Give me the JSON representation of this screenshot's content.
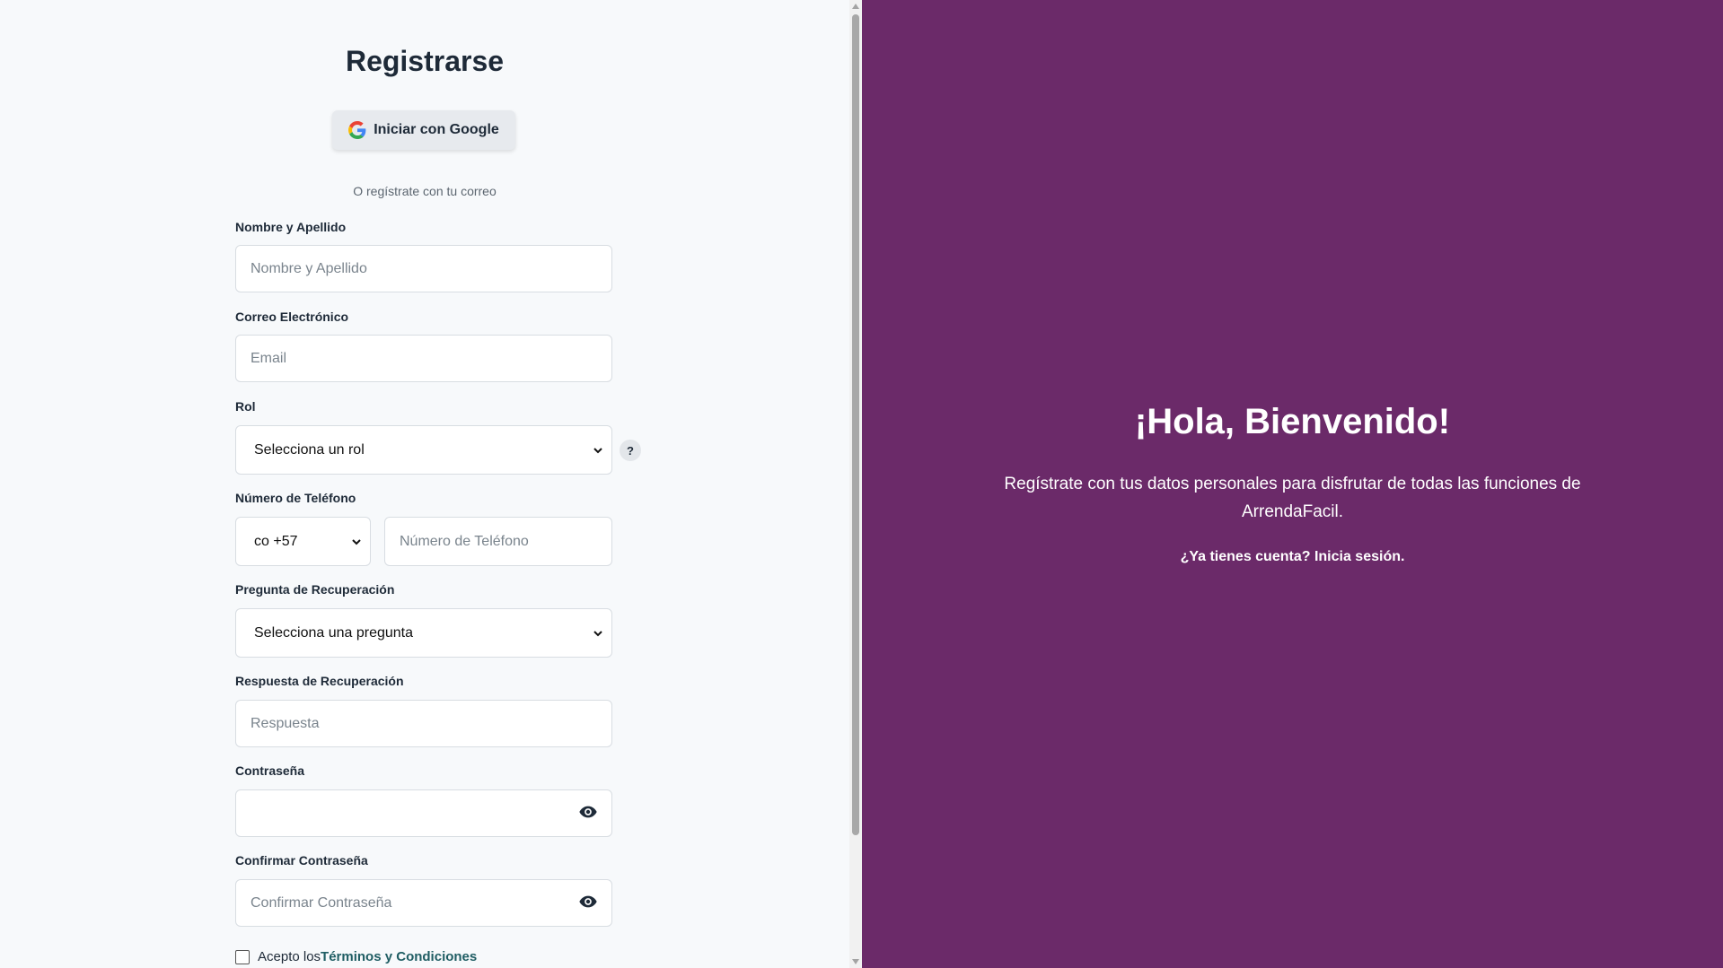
{
  "form": {
    "title": "Registrarse",
    "google_button": "Iniciar con Google",
    "divider": "O regístrate con tu correo",
    "name": {
      "label": "Nombre y Apellido",
      "placeholder": "Nombre y Apellido",
      "value": ""
    },
    "email": {
      "label": "Correo Electrónico",
      "placeholder": "Email",
      "value": ""
    },
    "role": {
      "label": "Rol",
      "selected": "Selecciona un rol",
      "help": "?"
    },
    "phone": {
      "label": "Número de Teléfono",
      "country": "co +57",
      "placeholder": "Número de Teléfono",
      "value": ""
    },
    "question": {
      "label": "Pregunta de Recuperación",
      "selected": "Selecciona una pregunta"
    },
    "answer": {
      "label": "Respuesta de Recuperación",
      "placeholder": "Respuesta",
      "value": ""
    },
    "password": {
      "label": "Contraseña",
      "placeholder": "",
      "value": ""
    },
    "confirm": {
      "label": "Confirmar Contraseña",
      "placeholder": "Confirmar Contraseña",
      "value": ""
    },
    "terms": {
      "prefix": "Acepto los",
      "link": "Términos y Condiciones",
      "checked": false
    }
  },
  "welcome": {
    "title": "¡Hola, Bienvenido!",
    "subtitle": "Regístrate con tus datos personales para disfrutar de todas las funciones de ArrendaFacil.",
    "login_link": "¿Ya tienes cuenta? Inicia sesión."
  },
  "colors": {
    "panel_bg": "#6b2a69",
    "page_bg": "#f7f9fb",
    "terms_link": "#1f5d63"
  },
  "icons": {
    "google": "google-icon",
    "chevron": "chevron-down-icon",
    "eye": "eye-icon",
    "help": "help-icon"
  }
}
